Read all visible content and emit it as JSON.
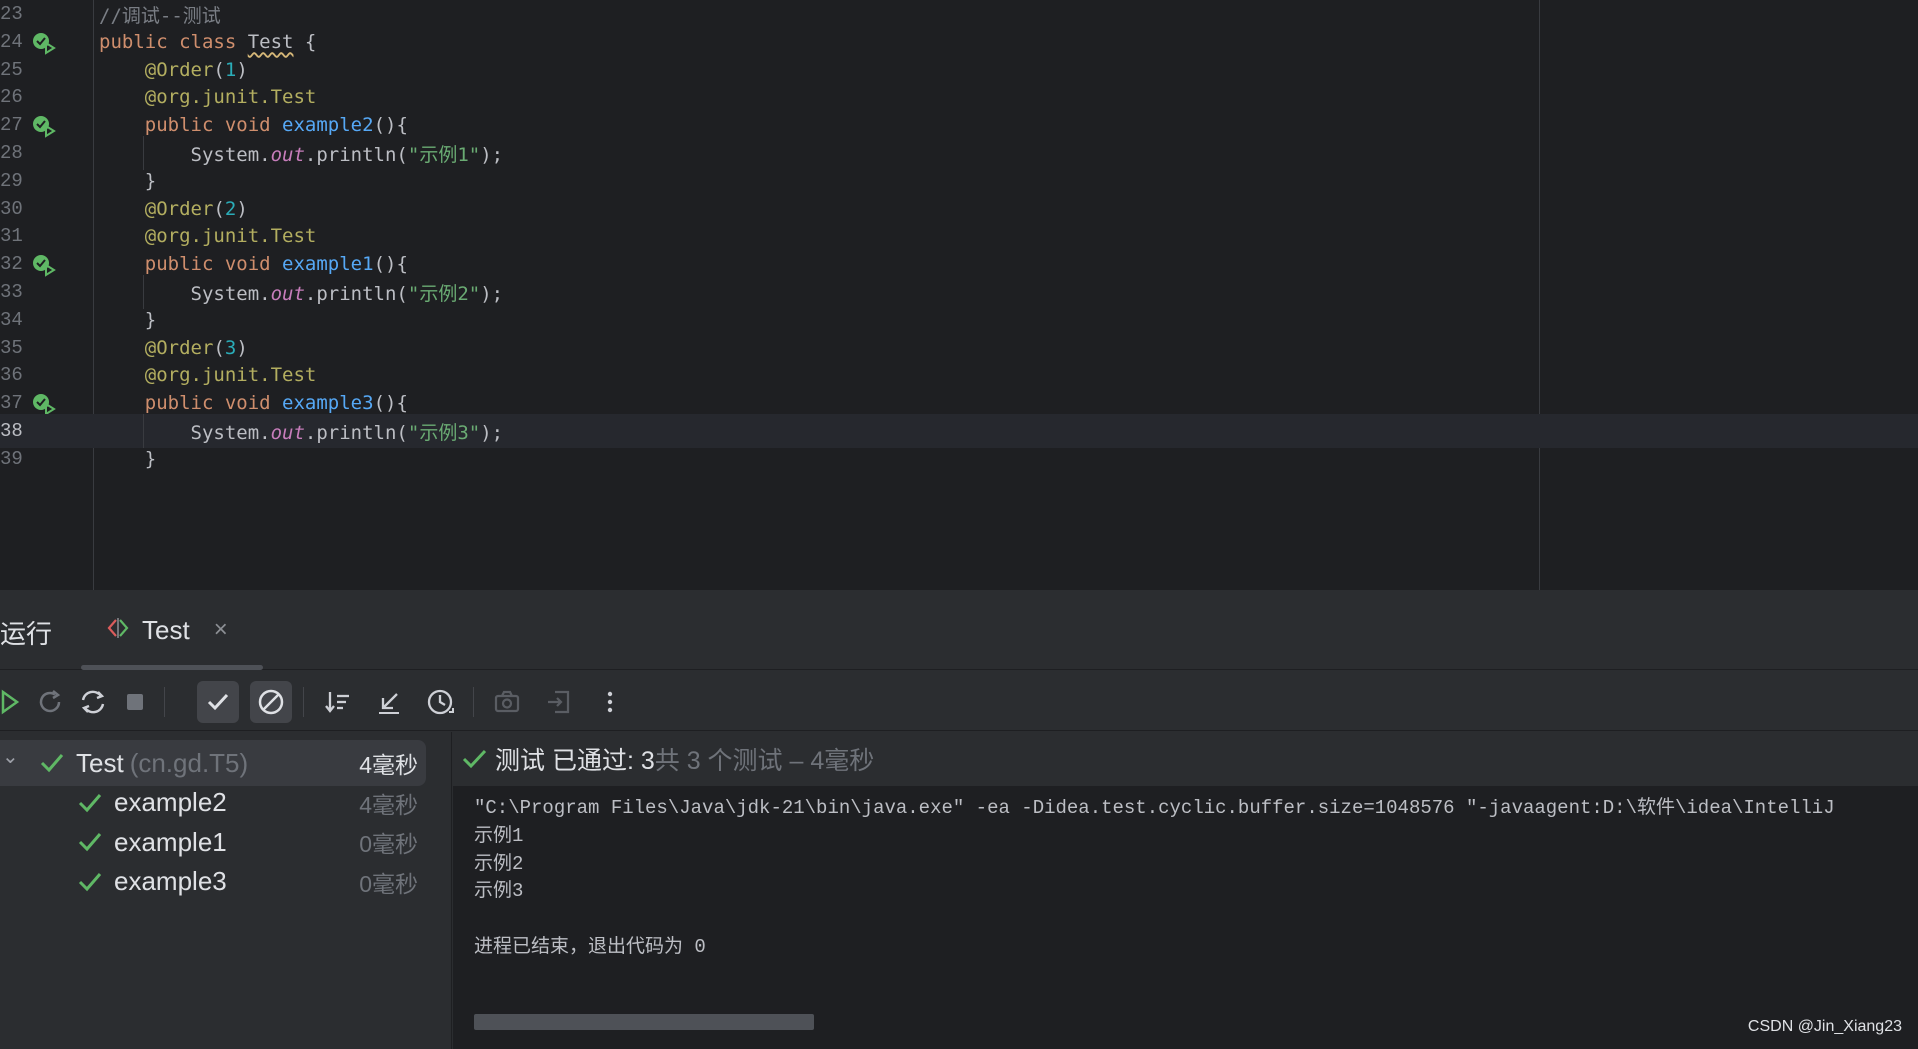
{
  "editor": {
    "lines": [
      {
        "num": "23",
        "tokens": [
          {
            "t": "//调试--测试",
            "c": "cm"
          }
        ],
        "guide": false
      },
      {
        "num": "24",
        "tokens": [
          {
            "t": "public class ",
            "c": "kw"
          },
          {
            "t": "Test",
            "c": "squiggle"
          },
          {
            "t": " {",
            "c": ""
          }
        ],
        "guide": false,
        "run_icon": true
      },
      {
        "num": "25",
        "tokens": [
          {
            "t": "    ",
            "c": ""
          },
          {
            "t": "@Order",
            "c": "ann"
          },
          {
            "t": "(",
            "c": ""
          },
          {
            "t": "1",
            "c": "num"
          },
          {
            "t": ")",
            "c": ""
          }
        ],
        "guide": false
      },
      {
        "num": "26",
        "tokens": [
          {
            "t": "    ",
            "c": ""
          },
          {
            "t": "@org.junit.",
            "c": "ann"
          },
          {
            "t": "Test",
            "c": "ann"
          }
        ],
        "guide": false
      },
      {
        "num": "27",
        "tokens": [
          {
            "t": "    ",
            "c": ""
          },
          {
            "t": "public void ",
            "c": "kw"
          },
          {
            "t": "example2",
            "c": "fn"
          },
          {
            "t": "(){",
            "c": ""
          }
        ],
        "guide": false,
        "run_icon": true
      },
      {
        "num": "28",
        "tokens": [
          {
            "t": "        System.",
            "c": ""
          },
          {
            "t": "out",
            "c": "fld"
          },
          {
            "t": ".println(",
            "c": ""
          },
          {
            "t": "\"示例1\"",
            "c": "str"
          },
          {
            "t": ");",
            "c": ""
          }
        ],
        "guide": true
      },
      {
        "num": "29",
        "tokens": [
          {
            "t": "    }",
            "c": ""
          }
        ],
        "guide": false
      },
      {
        "num": "30",
        "tokens": [
          {
            "t": "    ",
            "c": ""
          },
          {
            "t": "@Order",
            "c": "ann"
          },
          {
            "t": "(",
            "c": ""
          },
          {
            "t": "2",
            "c": "num"
          },
          {
            "t": ")",
            "c": ""
          }
        ],
        "guide": false
      },
      {
        "num": "31",
        "tokens": [
          {
            "t": "    ",
            "c": ""
          },
          {
            "t": "@org.junit.",
            "c": "ann"
          },
          {
            "t": "Test",
            "c": "ann"
          }
        ],
        "guide": false
      },
      {
        "num": "32",
        "tokens": [
          {
            "t": "    ",
            "c": ""
          },
          {
            "t": "public void ",
            "c": "kw"
          },
          {
            "t": "example1",
            "c": "fn"
          },
          {
            "t": "(){",
            "c": ""
          }
        ],
        "guide": false,
        "run_icon": true
      },
      {
        "num": "33",
        "tokens": [
          {
            "t": "        System.",
            "c": ""
          },
          {
            "t": "out",
            "c": "fld"
          },
          {
            "t": ".println(",
            "c": ""
          },
          {
            "t": "\"示例2\"",
            "c": "str"
          },
          {
            "t": ");",
            "c": ""
          }
        ],
        "guide": true
      },
      {
        "num": "34",
        "tokens": [
          {
            "t": "    }",
            "c": ""
          }
        ],
        "guide": false
      },
      {
        "num": "35",
        "tokens": [
          {
            "t": "    ",
            "c": ""
          },
          {
            "t": "@Order",
            "c": "ann"
          },
          {
            "t": "(",
            "c": ""
          },
          {
            "t": "3",
            "c": "num"
          },
          {
            "t": ")",
            "c": ""
          }
        ],
        "guide": false
      },
      {
        "num": "36",
        "tokens": [
          {
            "t": "    ",
            "c": ""
          },
          {
            "t": "@org.junit.",
            "c": "ann"
          },
          {
            "t": "Test",
            "c": "ann"
          }
        ],
        "guide": false
      },
      {
        "num": "37",
        "tokens": [
          {
            "t": "    ",
            "c": ""
          },
          {
            "t": "public void ",
            "c": "kw"
          },
          {
            "t": "example3",
            "c": "fn"
          },
          {
            "t": "(){",
            "c": ""
          }
        ],
        "guide": false,
        "run_icon": true
      },
      {
        "num": "38",
        "tokens": [
          {
            "t": "        System.",
            "c": ""
          },
          {
            "t": "out",
            "c": "fld"
          },
          {
            "t": ".println(",
            "c": ""
          },
          {
            "t": "\"示例3\"",
            "c": "str"
          },
          {
            "t": ");",
            "c": ""
          }
        ],
        "guide": true,
        "current": true
      },
      {
        "num": "39",
        "tokens": [
          {
            "t": "    }",
            "c": ""
          }
        ],
        "guide": false
      }
    ]
  },
  "run_panel": {
    "label": "运行",
    "tab_label": "Test",
    "tab_close": "×",
    "toolbar_icons": [
      "rerun-icon",
      "rerun-failed-icon",
      "toggle-auto-test-icon",
      "stop-icon",
      "show-passed-icon",
      "show-ignored-icon",
      "sort-icon",
      "collapse-icon",
      "history-icon",
      "screenshot-icon",
      "export-icon",
      "more-icon"
    ],
    "tree": [
      {
        "name": "Test",
        "pkg": "(cn.gd.T5)",
        "time": "4毫秒",
        "root": true
      },
      {
        "name": "example2",
        "pkg": "",
        "time": "4毫秒",
        "root": false
      },
      {
        "name": "example1",
        "pkg": "",
        "time": "0毫秒",
        "root": false
      },
      {
        "name": "example3",
        "pkg": "",
        "time": "0毫秒",
        "root": false
      }
    ],
    "status": {
      "passed": "测试 已通过: 3",
      "total": "共 3 个测试 – 4毫秒"
    },
    "console": [
      "\"C:\\Program Files\\Java\\jdk-21\\bin\\java.exe\" -ea -Didea.test.cyclic.buffer.size=1048576 \"-javaagent:D:\\软件\\idea\\IntelliJ",
      "示例1",
      "示例2",
      "示例3",
      "",
      "进程已结束，退出代码为 0"
    ]
  },
  "watermark": "CSDN @Jin_Xiang23",
  "colors": {
    "editor_bg": "#1e1f22",
    "panel_bg": "#2b2d30",
    "keyword": "#cf8e6d",
    "annotation": "#b3ae60",
    "number": "#2aacb8",
    "function": "#56a8f5",
    "string": "#6aab73",
    "field": "#c77dbb",
    "pass_green": "#5fb865"
  }
}
